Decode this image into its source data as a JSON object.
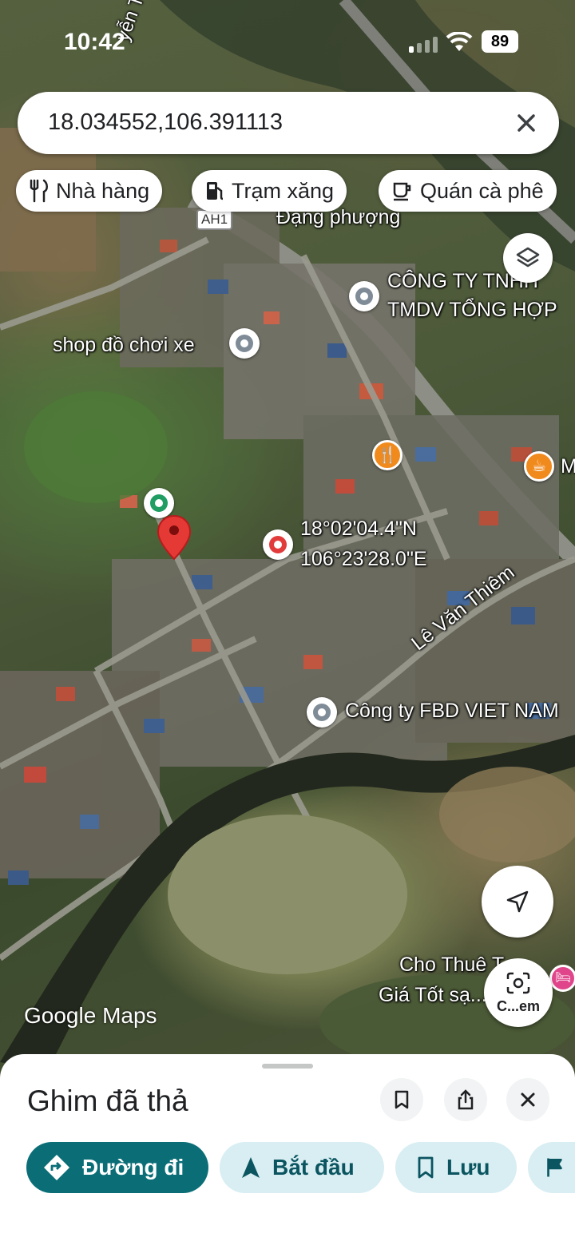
{
  "status_bar": {
    "time": "10:42",
    "battery": "89"
  },
  "search": {
    "value": "18.034552,106.391113"
  },
  "chips": [
    {
      "label": "Nhà hàng",
      "icon": "restaurant-icon"
    },
    {
      "label": "Trạm xăng",
      "icon": "gas-station-icon"
    },
    {
      "label": "Quán cà phê",
      "icon": "coffee-icon"
    }
  ],
  "map": {
    "road_label_top": "yễn Trãi",
    "highway_badge": "AH1",
    "labels": {
      "dang_phuong": "Đạng phượng",
      "cong_ty_1": "CÔNG TY TNHH",
      "cong_ty_2": "TMDV TỔNG HỢP",
      "shop": "shop đồ chơi xe",
      "coord_lat": "18°02'04.4\"N",
      "coord_lon": "106°23'28.0\"E",
      "le_van_thiem": "Lê Văn Thiêm",
      "fbd": "Công ty FBD VIET NAM",
      "cho_thue_1": "Cho Thuê T...",
      "cho_thue_2": "Giá Tốt sạ...",
      "orange_m": "M",
      "lens_label": "C...em"
    },
    "attribution": "Google Maps"
  },
  "sheet": {
    "title": "Ghim đã thả",
    "actions": {
      "directions": "Đường đi",
      "start": "Bắt đầu",
      "save": "Lưu"
    }
  }
}
